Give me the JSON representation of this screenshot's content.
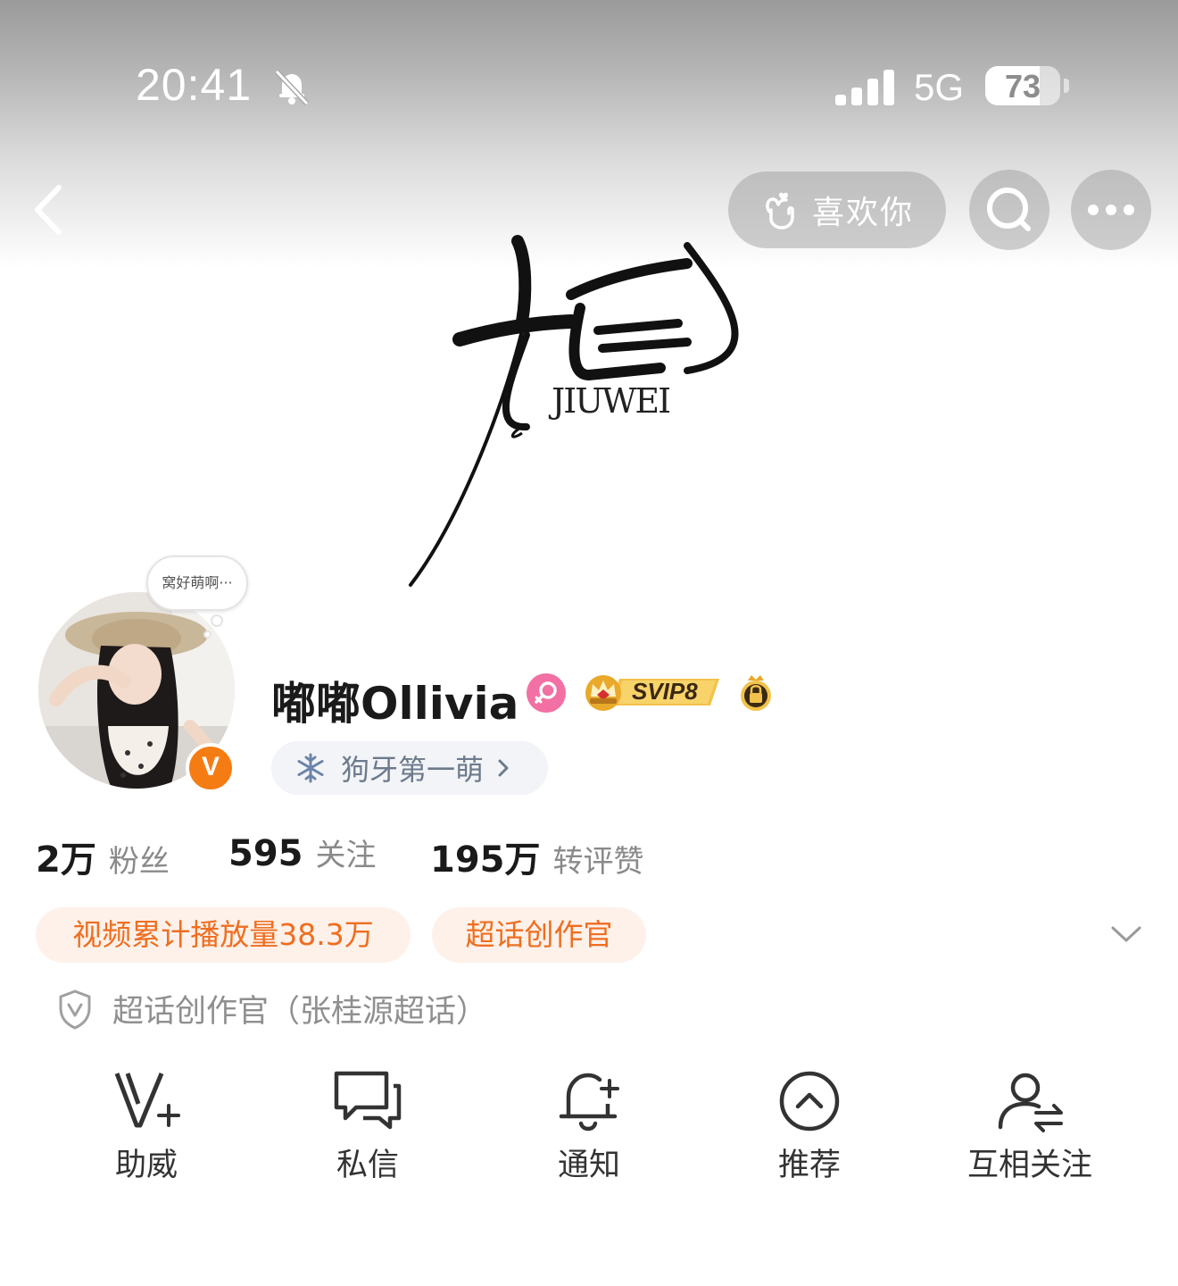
{
  "status_bar": {
    "time": "20:41",
    "network": "5G",
    "battery": "73",
    "battery_level": 0.73
  },
  "nav": {
    "like_label": "喜欢你"
  },
  "profile": {
    "avatar_bubble": "窝好萌啊···",
    "name": "嘟嘟Ollivia",
    "svip_label": "SVIP8",
    "group_label": "狗牙第一萌",
    "verify_mark": "V"
  },
  "stats": [
    {
      "value": "2万",
      "label": "粉丝"
    },
    {
      "value": "595",
      "label": "关注"
    },
    {
      "value": "195万",
      "label": "转评赞"
    }
  ],
  "tags": [
    {
      "label": "视频累计播放量38.3万"
    },
    {
      "label": "超话创作官"
    }
  ],
  "certification": "超话创作官（张桂源超话）",
  "actions": [
    {
      "label": "助威",
      "icon": "v-plus-icon"
    },
    {
      "label": "私信",
      "icon": "chat-icon"
    },
    {
      "label": "通知",
      "icon": "bell-plus-icon"
    },
    {
      "label": "推荐",
      "icon": "chevron-up-circle-icon"
    },
    {
      "label": "互相关注",
      "icon": "user-swap-icon"
    }
  ],
  "colors": {
    "accent_orange": "#ef6e20",
    "tag_bg": "#fdf1ea",
    "verify_orange": "#f57c13",
    "female_pink": "#f270a3",
    "svip_gold": "#f3c24b"
  }
}
